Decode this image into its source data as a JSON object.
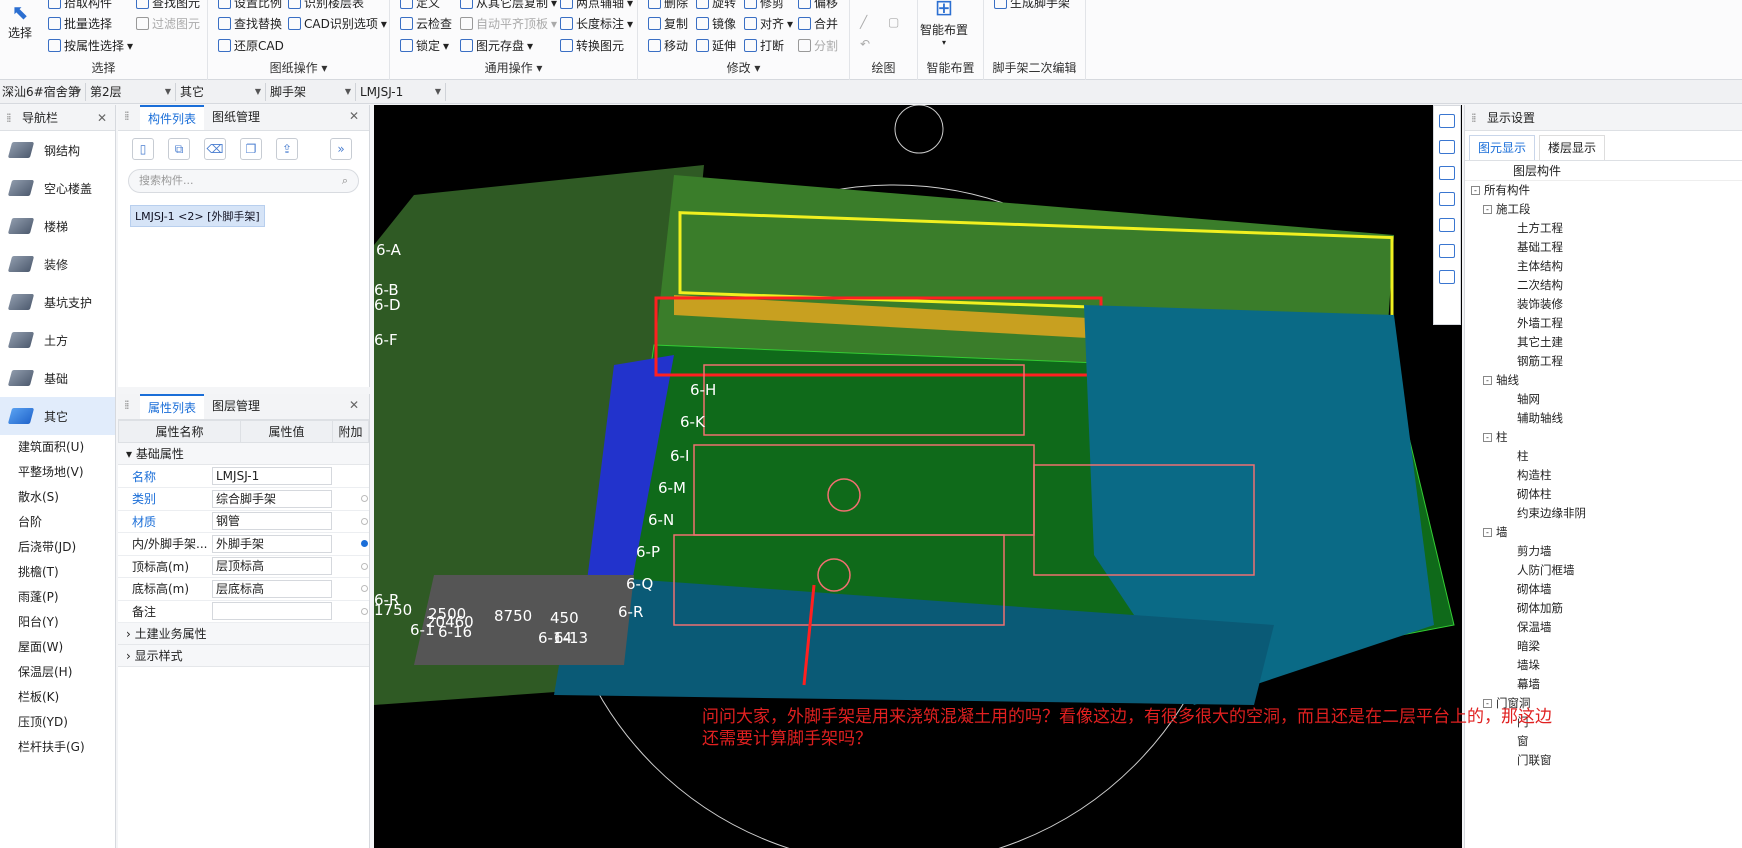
{
  "ribbon": {
    "select": {
      "big": "选择",
      "items": [
        "拾取构件",
        "批量选择",
        "按属性选择",
        "查找图元",
        "过滤图元"
      ],
      "label": "选择"
    },
    "drawing": {
      "items": [
        "设置比例",
        "查找替换",
        "还原CAD",
        "识别楼层表",
        "CAD识别选项"
      ],
      "label": "图纸操作"
    },
    "common": {
      "items": [
        "定义",
        "云检查",
        "锁定",
        "从其它层复制",
        "自动平齐顶板",
        "图元存盘",
        "两点辅轴",
        "长度标注",
        "转换图元"
      ],
      "label": "通用操作"
    },
    "modify": {
      "items": [
        "删除",
        "复制",
        "移动",
        "旋转",
        "镜像",
        "延伸",
        "修剪",
        "对齐",
        "打断",
        "偏移",
        "合并",
        "分割"
      ],
      "label": "修改"
    },
    "draw": {
      "label": "绘图"
    },
    "smart": {
      "big": "智能布置",
      "label": "智能布置"
    },
    "scaffold": {
      "items": [
        "生成脚手架"
      ],
      "label": "脚手架二次编辑"
    }
  },
  "selectors": [
    "深汕6#宿舍第二",
    "第2层",
    "其它",
    "脚手架",
    "LMJSJ-1"
  ],
  "nav": {
    "title": "导航栏",
    "items": [
      "钢结构",
      "空心楼盖",
      "楼梯",
      "装修",
      "基坑支护",
      "土方",
      "基础",
      "其它"
    ],
    "subitems": [
      "建筑面积(U)",
      "平整场地(V)",
      "散水(S)",
      "台阶",
      "后浇带(JD)",
      "挑檐(T)",
      "雨蓬(P)",
      "阳台(Y)",
      "屋面(W)",
      "保温层(H)",
      "栏板(K)",
      "压顶(YD)",
      "栏杆扶手(G)"
    ]
  },
  "components": {
    "tabs": [
      "构件列表",
      "图纸管理"
    ],
    "search_placeholder": "搜索构件...",
    "selected": "LMJSJ-1 <2> [外脚手架]"
  },
  "properties": {
    "tabs": [
      "属性列表",
      "图层管理"
    ],
    "headers": [
      "属性名称",
      "属性值",
      "附加"
    ],
    "group": "基础属性",
    "rows": [
      {
        "name": "名称",
        "value": "LMJSJ-1"
      },
      {
        "name": "类别",
        "value": "综合脚手架"
      },
      {
        "name": "材质",
        "value": "钢管"
      },
      {
        "name": "内/外脚手架...",
        "value": "外脚手架"
      },
      {
        "name": "顶标高(m)",
        "value": "层顶标高"
      },
      {
        "name": "底标高(m)",
        "value": "层底标高"
      },
      {
        "name": "备注",
        "value": ""
      }
    ],
    "more": [
      "土建业务属性",
      "显示样式"
    ]
  },
  "canvas": {
    "axis_labels": [
      "6-A",
      "6-B",
      "6-D",
      "6-F",
      "6-H",
      "6-K",
      "6-I",
      "6-M",
      "6-N",
      "6-P",
      "6-Q",
      "6-R",
      "6-R"
    ],
    "dims": [
      "1750",
      "2500",
      "20460",
      "8750",
      "450",
      "6-1",
      "6-16",
      "6-14",
      "6-13"
    ]
  },
  "display": {
    "title": "显示设置",
    "tabs": [
      "图元显示",
      "楼层显示"
    ],
    "column": "图层构件",
    "tree": [
      {
        "t": "所有构件",
        "l": 0,
        "box": "-"
      },
      {
        "t": "施工段",
        "l": 1,
        "box": "-"
      },
      {
        "t": "土方工程",
        "l": 2
      },
      {
        "t": "基础工程",
        "l": 2
      },
      {
        "t": "主体结构",
        "l": 2
      },
      {
        "t": "二次结构",
        "l": 2
      },
      {
        "t": "装饰装修",
        "l": 2
      },
      {
        "t": "外墙工程",
        "l": 2
      },
      {
        "t": "其它土建",
        "l": 2
      },
      {
        "t": "钢筋工程",
        "l": 2
      },
      {
        "t": "轴线",
        "l": 1,
        "box": "-"
      },
      {
        "t": "轴网",
        "l": 2
      },
      {
        "t": "辅助轴线",
        "l": 2
      },
      {
        "t": "柱",
        "l": 1,
        "box": "-"
      },
      {
        "t": "柱",
        "l": 2
      },
      {
        "t": "构造柱",
        "l": 2
      },
      {
        "t": "砌体柱",
        "l": 2
      },
      {
        "t": "约束边缘非阴",
        "l": 2
      },
      {
        "t": "墙",
        "l": 1,
        "box": "-"
      },
      {
        "t": "剪力墙",
        "l": 2
      },
      {
        "t": "人防门框墙",
        "l": 2
      },
      {
        "t": "砌体墙",
        "l": 2
      },
      {
        "t": "砌体加筋",
        "l": 2
      },
      {
        "t": "保温墙",
        "l": 2
      },
      {
        "t": "暗梁",
        "l": 2
      },
      {
        "t": "墙垛",
        "l": 2
      },
      {
        "t": "幕墙",
        "l": 2
      },
      {
        "t": "门窗洞",
        "l": 1,
        "box": "-"
      },
      {
        "t": "门",
        "l": 2
      },
      {
        "t": "窗",
        "l": 2
      },
      {
        "t": "门联窗",
        "l": 2
      }
    ]
  },
  "annotation": "问问大家，外脚手架是用来浇筑混凝土用的吗？看像这边，有很多很大的空洞，而且还是在二层平台上的，那这边还需要计算脚手架吗？"
}
